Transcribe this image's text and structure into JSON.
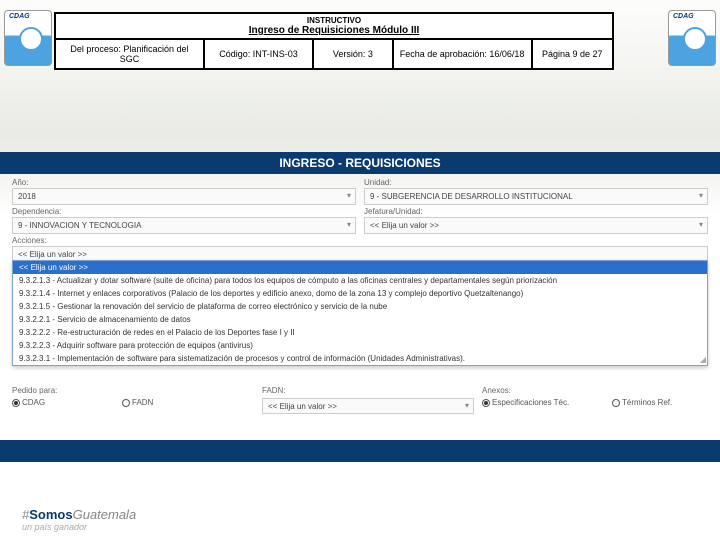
{
  "header": {
    "line1": "INSTRUCTIVO",
    "line2": "Ingreso de Requisiciones Módulo III",
    "proceso": "Del proceso: Planificación del SGC",
    "codigo": "Código: INT-INS-03",
    "version": "Versión: 3",
    "fecha": "Fecha de aprobación: 16/06/18",
    "pagina": "Página 9 de 27"
  },
  "title": "INGRESO - REQUISICIONES",
  "form": {
    "ano_label": "Año:",
    "ano_val": "2018",
    "unidad_label": "Unidad:",
    "unidad_val": "9 - SUBGERENCIA DE DESARROLLO INSTITUCIONAL",
    "dep_label": "Dependencia:",
    "dep_val": "9 - INNOVACION Y TECNOLOGIA",
    "jef_label": "Jefatura/Unidad:",
    "jef_val": "<< Elija un valor >>",
    "acc_label": "Acciones:",
    "acc_val": "<< Elija un valor >>"
  },
  "dropdown": [
    "<< Elija un valor >>",
    "9.3.2.1.3 - Actualizar y dotar software (suite de oficina) para todos los equipos de cómputo a las oficinas centrales y departamentales según priorización",
    "9.3.2.1.4 - Internet y enlaces corporativos (Palacio de los deportes y edificio anexo, domo de la zona 13 y complejo deportivo Quetzaltenango)",
    "9.3.2.1.5 - Gestionar la renovación del servicio de plataforma de correo electrónico y servicio de la nube",
    "9.3.2.2.1 - Servicio de almacenamiento de datos",
    "9.3.2.2.2 - Re-estructuración de redes en el Palacio de los Deportes fase I y II",
    "9.3.2.2.3 - Adquirir software para protección de equipos (antivirus)",
    "9.3.2.3.1 - Implementación de software para sistematización de procesos y control de información (Unidades Administrativas)."
  ],
  "radios": {
    "pedido_label": "Pedido para:",
    "cdag": "CDAG",
    "fadn": "FADN",
    "fadn_label": "FADN:",
    "fadn_val": "<< Elija un valor >>",
    "anexos_label": "Anexos:",
    "espec": "Especificaciones Téc.",
    "term": "Términos Ref."
  },
  "footer": {
    "hash": "#",
    "somos": "Somos",
    "guate": "Guatemala",
    "sub": "un país ganador"
  }
}
